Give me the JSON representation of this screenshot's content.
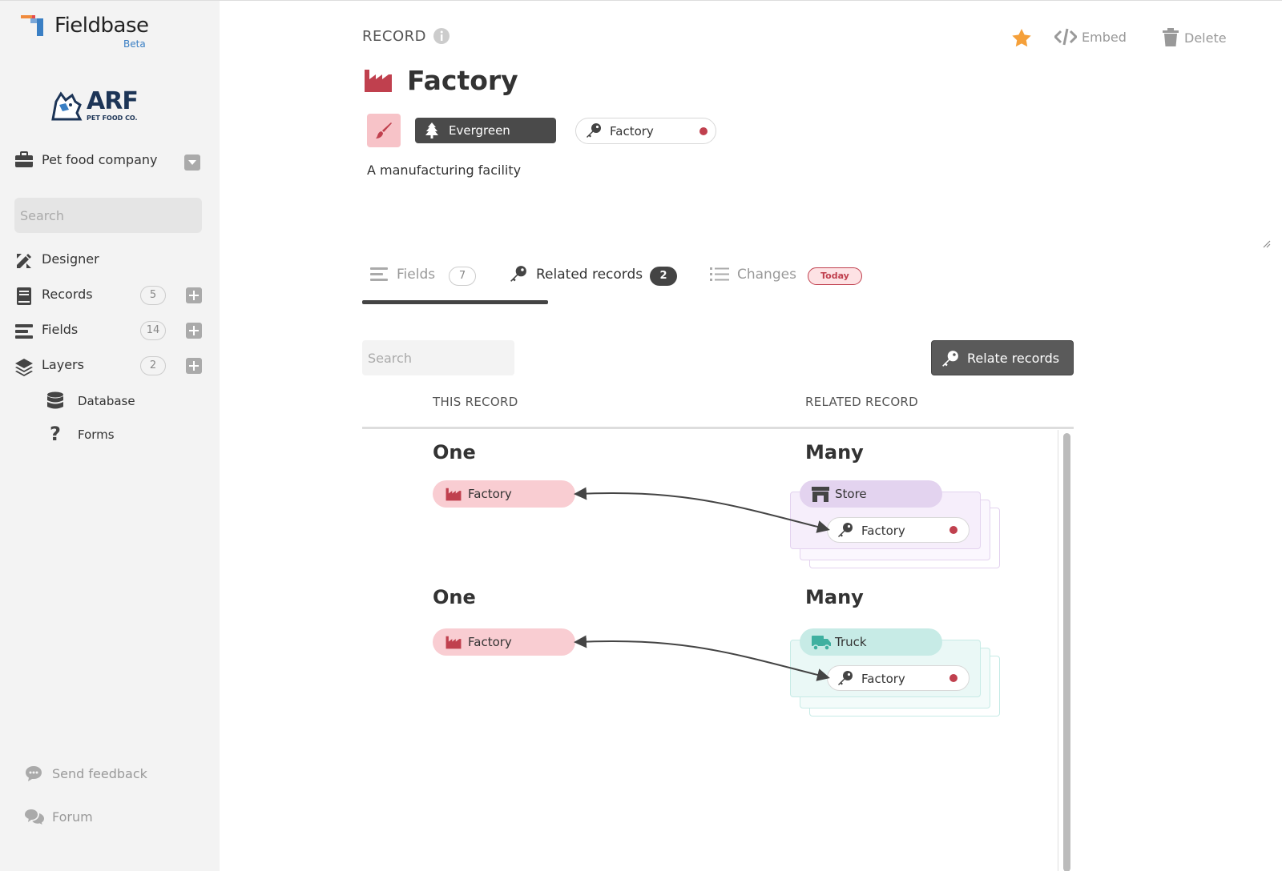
{
  "app": {
    "name": "Fieldbase",
    "badge": "Beta",
    "accent": "#3a7fc4"
  },
  "org": {
    "logo_word": "ARF",
    "logo_sub": "PET FOOD CO.",
    "name": "Pet food company",
    "search_placeholder": "Search"
  },
  "sidebar": {
    "items": [
      {
        "label": "Designer",
        "icon": "designer-icon"
      },
      {
        "label": "Records",
        "count": "5",
        "icon": "book-icon"
      },
      {
        "label": "Fields",
        "count": "14",
        "icon": "fields-icon"
      },
      {
        "label": "Layers",
        "count": "2",
        "icon": "layers-icon"
      }
    ],
    "layers": [
      {
        "label": "Database",
        "icon": "database-icon"
      },
      {
        "label": "Forms",
        "icon": "question-icon"
      }
    ],
    "footer": [
      {
        "label": "Send feedback",
        "icon": "feedback-icon"
      },
      {
        "label": "Forum",
        "icon": "forum-icon"
      }
    ]
  },
  "record": {
    "section_label": "RECORD",
    "title": "Factory",
    "color": "#c0404e",
    "layer_chip": "Evergreen",
    "key_chip": "Factory",
    "description": "A manufacturing facility"
  },
  "actions": {
    "embed": "Embed",
    "delete": "Delete",
    "star_color": "#f5a03a"
  },
  "tabs": [
    {
      "label": "Fields",
      "badge": "7",
      "active": false
    },
    {
      "label": "Related records",
      "badge": "2",
      "active": true
    },
    {
      "label": "Changes",
      "badge": "Today",
      "active": false
    }
  ],
  "related": {
    "search_placeholder": "Search",
    "relate_button": "Relate records",
    "col_this": "THIS RECORD",
    "col_related": "RELATED RECORD",
    "rows": [
      {
        "this_card": "One",
        "this_record": "Factory",
        "related_card": "Many",
        "related_record": "Store",
        "related_key": "Factory",
        "color": "#e3d3ef"
      },
      {
        "this_card": "One",
        "this_record": "Factory",
        "related_card": "Many",
        "related_record": "Truck",
        "related_key": "Factory",
        "color": "#c7ebe6"
      }
    ]
  }
}
